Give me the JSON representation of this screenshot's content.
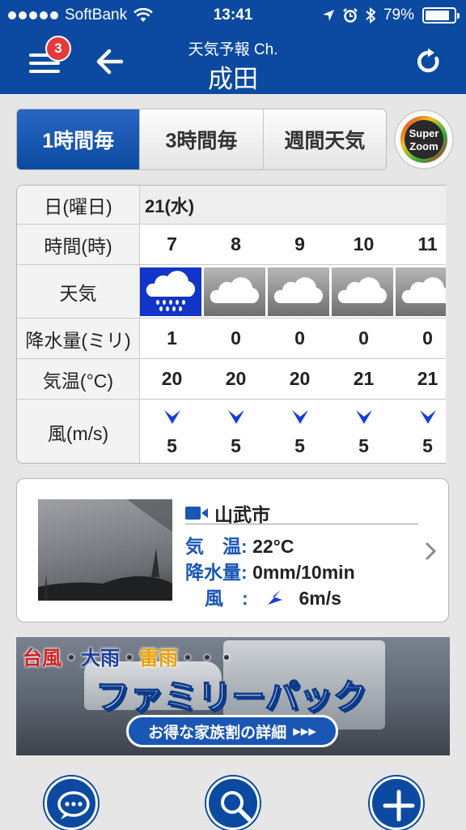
{
  "status_bar": {
    "carrier": "SoftBank",
    "time": "13:41",
    "battery": "79%"
  },
  "header": {
    "notification_count": "3",
    "subtitle": "天気予報 Ch.",
    "title": "成田"
  },
  "tabs": [
    {
      "label": "1時間毎",
      "active": true
    },
    {
      "label": "3時間毎",
      "active": false
    },
    {
      "label": "週間天気",
      "active": false
    }
  ],
  "superzoom": {
    "line1": "Super",
    "line2": "Zoom"
  },
  "forecast": {
    "labels": {
      "date": "日(曜日)",
      "hour": "時間(時)",
      "weather": "天気",
      "precip": "降水量(ミリ)",
      "temp": "気温(°C)",
      "wind": "風(m/s)"
    },
    "date": "21(水)",
    "hours": [
      "7",
      "8",
      "9",
      "10",
      "11"
    ],
    "weather": [
      "rain-icon",
      "cloud-icon",
      "cloud-icon",
      "cloud-icon",
      "cloud-icon"
    ],
    "precip": [
      "1",
      "0",
      "0",
      "0",
      "0"
    ],
    "temp": [
      "20",
      "20",
      "20",
      "21",
      "21"
    ],
    "wind": [
      "5",
      "5",
      "5",
      "5",
      "5"
    ]
  },
  "camera": {
    "location": "山武市",
    "temp_label": "気　温:",
    "temp_value": "22°C",
    "precip_label": "降水量:",
    "precip_value": "0mm/10min",
    "wind_label": "風　:",
    "wind_value": "6m/s"
  },
  "banner": {
    "tag1": "台風",
    "sep1": "・",
    "tag2": "大雨",
    "sep2": "・",
    "tag3": "雷雨",
    "tag_end": "・・・",
    "title": "ファミリーパック",
    "cta": "お得な家族割の詳細",
    "cta_arrows": "▸▸▸"
  },
  "colors": {
    "brand_blue": "#0b4aa0",
    "rain_cell": "#1234c8"
  }
}
